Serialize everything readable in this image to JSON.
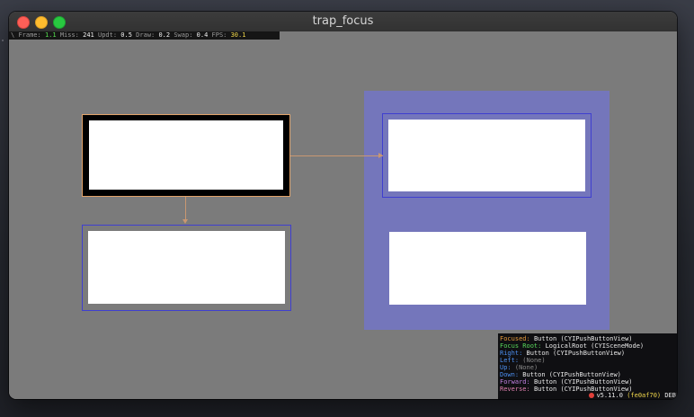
{
  "window": {
    "title": "trap_focus"
  },
  "stats": {
    "frame_label": "Frame:",
    "frame_value": "1.1",
    "miss_label": "Miss:",
    "miss_value": "241",
    "updt_label": "Updt:",
    "updt_value": "0.5",
    "draw_label": "Draw:",
    "draw_value": "0.2",
    "swap_label": "Swap:",
    "swap_value": "0.4",
    "fps_label": "FPS:",
    "fps_value": "30.1"
  },
  "debug": {
    "focused_label": "Focused:",
    "focused_value": "Button (CYIPushButtonView)",
    "focus_root_label": "Focus Root:",
    "focus_root_value": "LogicalRoot (CYISceneMode)",
    "right_label": "Right:",
    "right_value": "Button (CYIPushButtonView)",
    "left_label": "Left:",
    "left_value": "(None)",
    "up_label": "Up:",
    "up_value": "(None)",
    "down_label": "Down:",
    "down_value": "Button (CYIPushButtonView)",
    "forward_label": "Forward:",
    "forward_value": "Button (CYIPushButtonView)",
    "reverse_label": "Reverse:",
    "reverse_value": "Button (CYIPushButtonView)",
    "version": "v5.11.0",
    "commit": "(fe0af70)",
    "build": "DEB"
  },
  "colors": {
    "focus_outline": "#e3a46a",
    "candidate_outline": "#3f3fcf",
    "trap_panel": "#7476bb",
    "scene_bg": "#7b7b7b"
  }
}
